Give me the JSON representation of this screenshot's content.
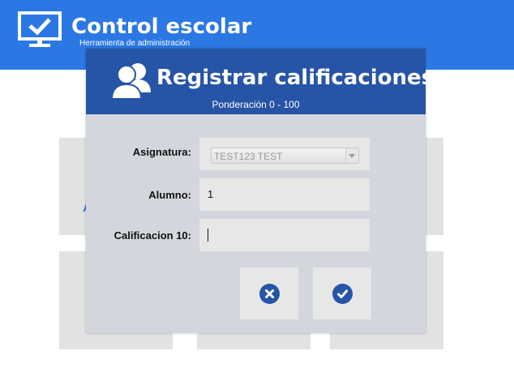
{
  "app": {
    "title": "Control escolar",
    "subtitle": "Herramienta de administración",
    "accent_color": "#2b78e4",
    "logo_icon": "monitor-check-icon"
  },
  "background": {
    "partial_label": "A"
  },
  "dialog": {
    "title": "Registrar calificaciones",
    "subtitle": "Ponderación 0 - 100",
    "header_color": "#2654a6",
    "header_icon": "users-icon",
    "fields": {
      "subject": {
        "label": "Asignatura:",
        "value": "TEST123 TEST"
      },
      "student": {
        "label": "Alumno:",
        "value": "1"
      },
      "grade": {
        "label": "Calificacion 10:",
        "value": ""
      }
    },
    "buttons": {
      "cancel_icon": "close-icon",
      "confirm_icon": "check-icon"
    }
  }
}
